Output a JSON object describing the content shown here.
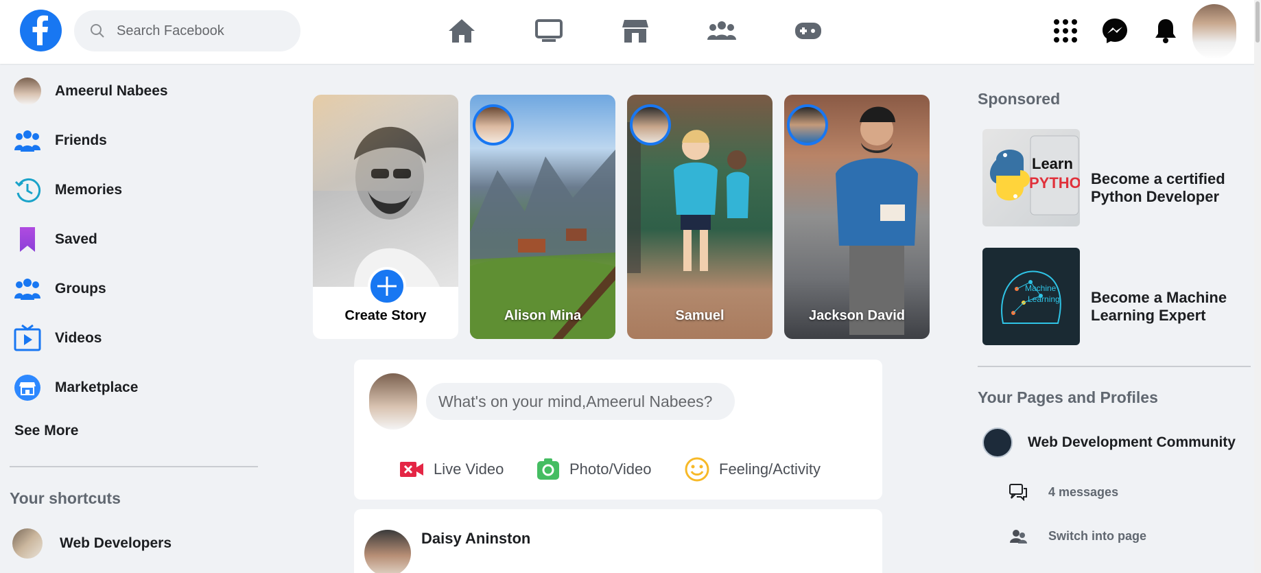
{
  "header": {
    "search_placeholder": "Search Facebook",
    "nav": [
      "home-icon",
      "watch-icon",
      "marketplace-icon",
      "groups-icon",
      "gaming-icon"
    ],
    "right": [
      "menu-grid-icon",
      "messenger-icon",
      "notifications-icon",
      "profile-avatar"
    ],
    "accent": "#1877f2"
  },
  "sidebar": {
    "items": [
      {
        "label": "Ameerul Nabees",
        "icon": "profile-avatar"
      },
      {
        "label": "Friends",
        "icon": "friends-icon"
      },
      {
        "label": "Memories",
        "icon": "memories-icon"
      },
      {
        "label": "Saved",
        "icon": "saved-icon"
      },
      {
        "label": "Groups",
        "icon": "groups-icon"
      },
      {
        "label": "Videos",
        "icon": "videos-icon"
      },
      {
        "label": "Marketplace",
        "icon": "marketplace-icon"
      }
    ],
    "see_more": "See More",
    "shortcuts_title": "Your shortcuts",
    "shortcuts": [
      {
        "label": "Web Developers"
      }
    ]
  },
  "stories": {
    "create_label": "Create Story",
    "items": [
      {
        "name": "Alison Mina"
      },
      {
        "name": "Samuel"
      },
      {
        "name": "Jackson David"
      }
    ]
  },
  "composer": {
    "placeholder": "What's on your mind,Ameerul Nabees?",
    "actions": [
      {
        "label": "Live Video",
        "icon": "live-video-icon",
        "color": "#e42645"
      },
      {
        "label": "Photo/Video",
        "icon": "photo-video-icon",
        "color": "#45bd62"
      },
      {
        "label": "Feeling/Activity",
        "icon": "feeling-icon",
        "color": "#f7b928"
      }
    ]
  },
  "feed": {
    "post_author": "Daisy Aninston"
  },
  "right": {
    "sponsored_title": "Sponsored",
    "ads": [
      {
        "text_1": "Become a certified",
        "text_2": "Python Developer",
        "image_line_1": "Learn",
        "image_line_2": "PYTHON"
      },
      {
        "text_1": "Become a Machine",
        "text_2": "Learning Expert",
        "image_line_1": "Machine",
        "image_line_2": "Learning"
      }
    ],
    "pages_title": "Your Pages and Profiles",
    "page_name": "Web Development Community",
    "messages": "4 messages",
    "switch": "Switch into page"
  }
}
